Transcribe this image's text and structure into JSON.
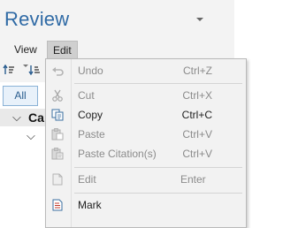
{
  "app": {
    "title": "Review"
  },
  "menubar": {
    "items": [
      {
        "label": "View"
      },
      {
        "label": "Edit"
      }
    ]
  },
  "toolbar": {
    "icons": [
      "sort-ascending-icon",
      "sort-descending-icon"
    ]
  },
  "filter": {
    "all_label": "All"
  },
  "tree": {
    "row1_text": "Ca"
  },
  "edit_menu": {
    "items": [
      {
        "label": "Undo",
        "shortcut": "Ctrl+Z",
        "enabled": false,
        "icon": "undo-icon"
      },
      {
        "label": "Cut",
        "shortcut": "Ctrl+X",
        "enabled": false,
        "icon": "cut-icon"
      },
      {
        "label": "Copy",
        "shortcut": "Ctrl+C",
        "enabled": true,
        "icon": "copy-icon"
      },
      {
        "label": "Paste",
        "shortcut": "Ctrl+V",
        "enabled": false,
        "icon": "paste-icon"
      },
      {
        "label": "Paste Citation(s)",
        "shortcut": "Ctrl+V",
        "enabled": false,
        "icon": "paste-citation-icon"
      },
      {
        "label": "Edit",
        "shortcut": "Enter",
        "enabled": false,
        "icon": "edit-icon"
      },
      {
        "label": "Mark",
        "shortcut": "",
        "enabled": true,
        "icon": "mark-icon"
      }
    ]
  },
  "colors": {
    "accent": "#2f6aa5",
    "menu_bg": "#f2f2f2",
    "disabled_text": "#8b8b8b"
  }
}
